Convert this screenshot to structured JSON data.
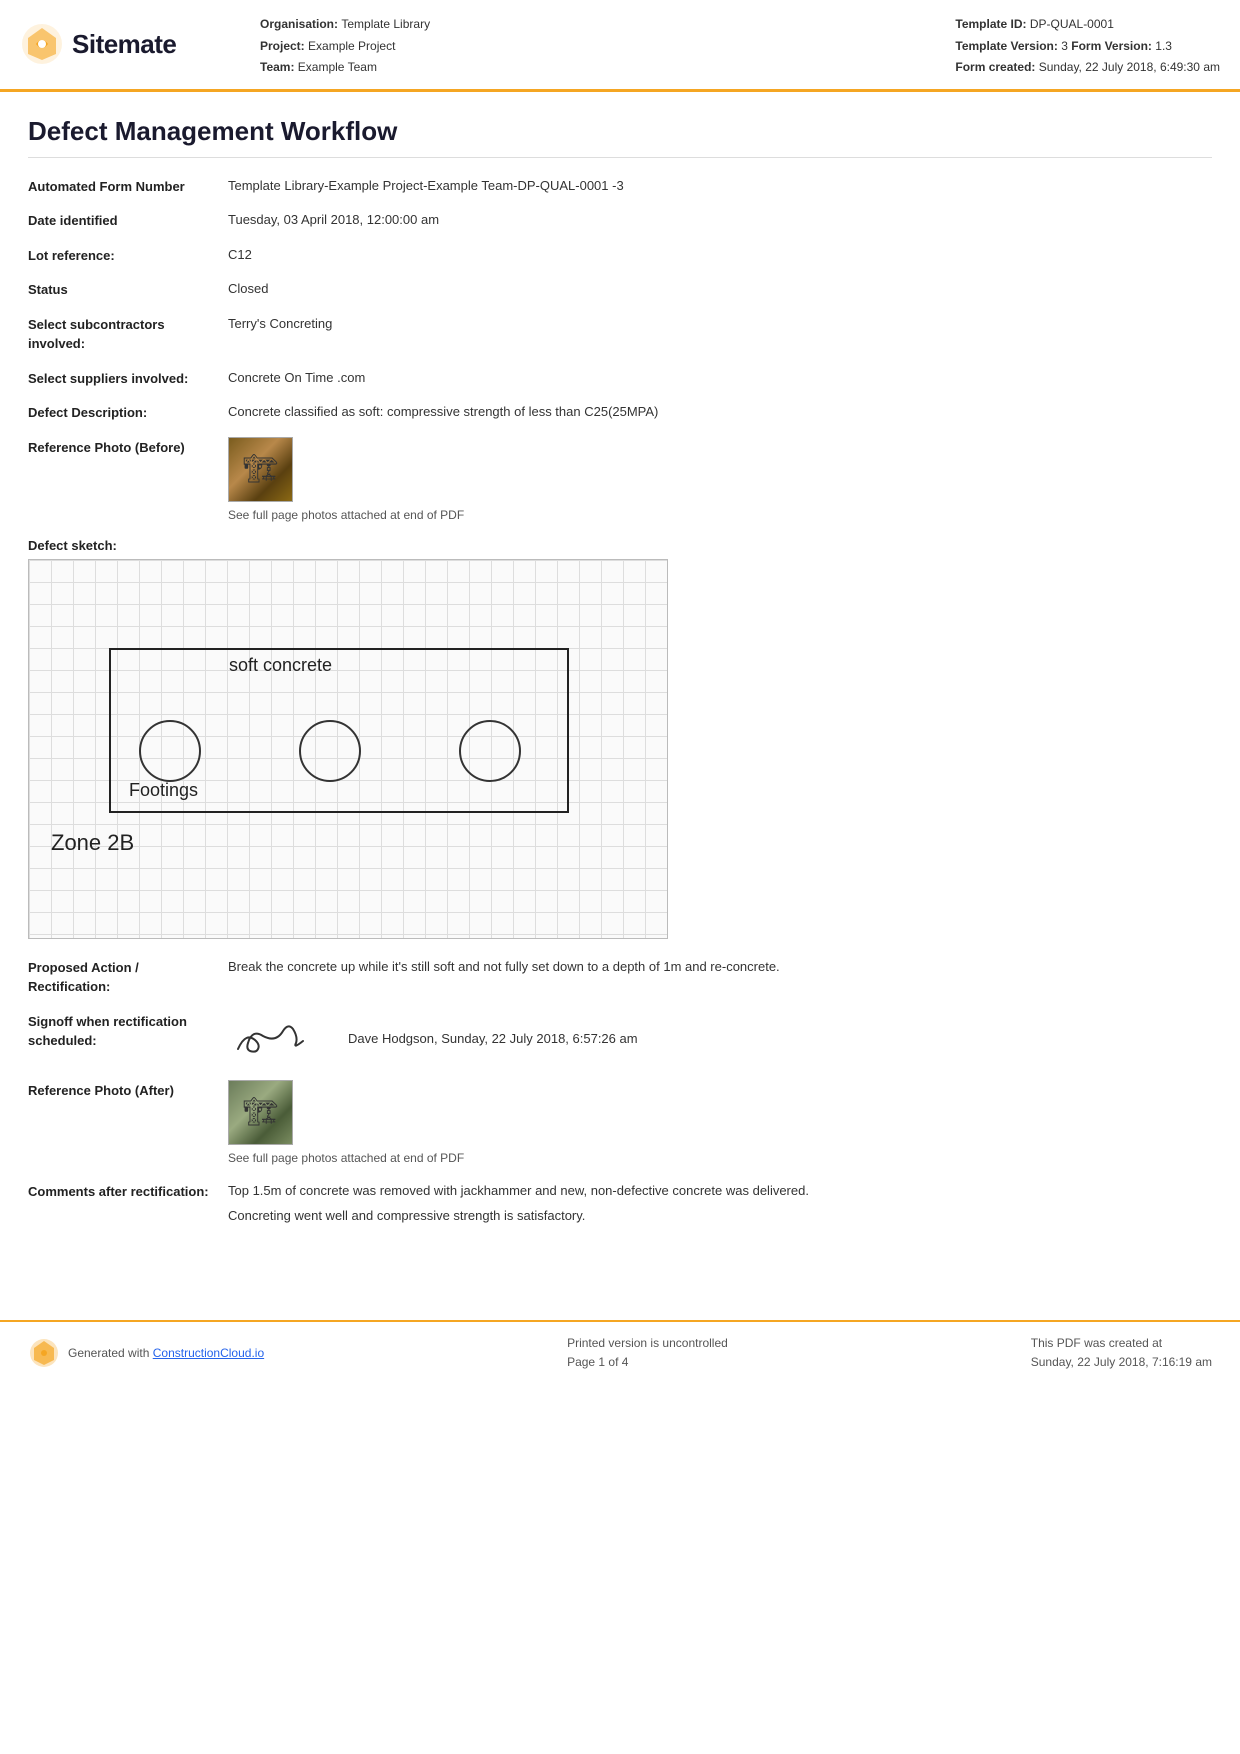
{
  "header": {
    "logo_text": "Sitemate",
    "org_label": "Organisation:",
    "org_value": "Template Library",
    "project_label": "Project:",
    "project_value": "Example Project",
    "team_label": "Team:",
    "team_value": "Example Team",
    "template_id_label": "Template ID:",
    "template_id_value": "DP-QUAL-0001",
    "template_version_label": "Template Version:",
    "template_version_value": "3",
    "form_version_label": "Form Version:",
    "form_version_value": "1.3",
    "form_created_label": "Form created:",
    "form_created_value": "Sunday, 22 July 2018, 6:49:30 am"
  },
  "page": {
    "title": "Defect Management Workflow"
  },
  "fields": {
    "automated_form_number_label": "Automated Form Number",
    "automated_form_number_value": "Template Library-Example Project-Example Team-DP-QUAL-0001   -3",
    "date_identified_label": "Date identified",
    "date_identified_value": "Tuesday, 03 April 2018, 12:00:00 am",
    "lot_reference_label": "Lot reference:",
    "lot_reference_value": "C12",
    "status_label": "Status",
    "status_value": "Closed",
    "select_subcontractors_label": "Select subcontractors involved:",
    "select_subcontractors_value": "Terry's Concreting",
    "select_suppliers_label": "Select suppliers involved:",
    "select_suppliers_value": "Concrete On Time .com",
    "defect_description_label": "Defect Description:",
    "defect_description_value": "Concrete classified as soft: compressive strength of less than C25(25MPA)",
    "reference_photo_before_label": "Reference Photo (Before)",
    "reference_photo_before_caption": "See full page photos attached at end of PDF",
    "defect_sketch_label": "Defect sketch:",
    "sketch_text_soft_concrete": "soft concrete",
    "sketch_text_footings": "Footings",
    "sketch_text_zone": "Zone 2B",
    "proposed_action_label": "Proposed Action / Rectification:",
    "proposed_action_value": "Break the concrete up while it's still soft and not fully set down to a depth of 1m and re-concrete.",
    "signoff_label": "Signoff when rectification scheduled:",
    "signoff_person": "Dave Hodgson, Sunday, 22 July 2018, 6:57:26 am",
    "reference_photo_after_label": "Reference Photo (After)",
    "reference_photo_after_caption": "See full page photos attached at end of PDF",
    "comments_label": "Comments after rectification:",
    "comments_value_1": "Top 1.5m of concrete was removed with jackhammer and new, non-defective concrete was delivered.",
    "comments_value_2": "Concreting went well and compressive strength is satisfactory."
  },
  "footer": {
    "generated_text": "Generated with",
    "link_text": "ConstructionCloud.io",
    "center_line1": "Printed version is uncontrolled",
    "center_line2": "Page 1 of 4",
    "right_line1": "This PDF was created at",
    "right_line2": "Sunday, 22 July 2018, 7:16:19 am"
  }
}
